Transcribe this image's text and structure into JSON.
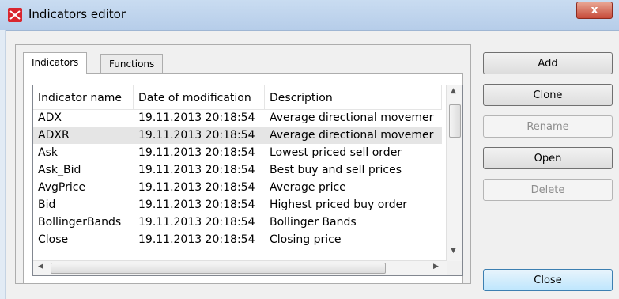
{
  "window": {
    "title": "Indicators editor",
    "close_glyph": "x"
  },
  "tabs": [
    {
      "label": "Indicators",
      "active": true
    },
    {
      "label": "Functions",
      "active": false
    }
  ],
  "table": {
    "columns": [
      "Indicator name",
      "Date of modification",
      "Description"
    ],
    "rows": [
      {
        "name": "ADX",
        "date": "19.11.2013 20:18:54",
        "desc": "Average directional movemer",
        "selected": false
      },
      {
        "name": "ADXR",
        "date": "19.11.2013 20:18:54",
        "desc": "Average directional movemer",
        "selected": true
      },
      {
        "name": "Ask",
        "date": "19.11.2013 20:18:54",
        "desc": "Lowest priced sell order",
        "selected": false
      },
      {
        "name": "Ask_Bid",
        "date": "19.11.2013 20:18:54",
        "desc": "Best buy and sell prices",
        "selected": false
      },
      {
        "name": "AvgPrice",
        "date": "19.11.2013 20:18:54",
        "desc": "Average price",
        "selected": false
      },
      {
        "name": "Bid",
        "date": "19.11.2013 20:18:54",
        "desc": "Highest priced buy order",
        "selected": false
      },
      {
        "name": "BollingerBands",
        "date": "19.11.2013 20:18:54",
        "desc": "Bollinger Bands",
        "selected": false
      },
      {
        "name": "Close",
        "date": "19.11.2013 20:18:54",
        "desc": "Closing price",
        "selected": false
      }
    ]
  },
  "buttons": {
    "add": "Add",
    "clone": "Clone",
    "rename": "Rename",
    "open": "Open",
    "delete": "Delete",
    "close": "Close"
  },
  "icons": {
    "app": "app-logo-icon",
    "scroll_up": "chevron-up-icon",
    "scroll_down": "chevron-down-icon",
    "scroll_left": "chevron-left-icon",
    "scroll_right": "chevron-right-icon"
  },
  "colors": {
    "accent": "#d9262e",
    "selection": "#e5e5e5"
  }
}
